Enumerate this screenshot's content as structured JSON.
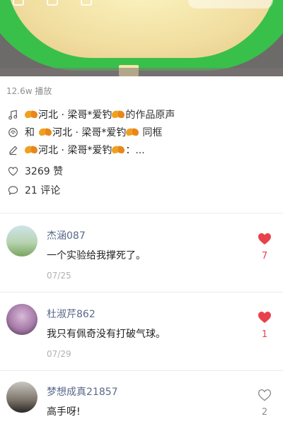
{
  "video": {
    "plays": "12.6w 播放"
  },
  "info": {
    "music_author": "河北 · 梁哥*爱钓",
    "music_suffix": "的作品原声",
    "duet_prefix": "和",
    "duet_author": "河北 · 梁哥*爱钓",
    "duet_suffix": "同框",
    "edit_author": "河北 · 梁哥*爱钓",
    "edit_suffix": "：...",
    "likes": "3269 赞",
    "comments": "21 评论"
  },
  "comments": [
    {
      "name": "杰涵087",
      "text": "一个实验给我撑死了。",
      "date": "07/25",
      "likes": "7",
      "liked": true
    },
    {
      "name": "杜淑芹862",
      "text": "我只有佩奇没有打破气球。",
      "date": "07/29",
      "likes": "1",
      "liked": true
    },
    {
      "name": "梦想成真21857",
      "text": "高手呀!",
      "date": "",
      "likes": "2",
      "liked": false
    }
  ],
  "icons": {
    "music": "music-note-icon",
    "duet": "duet-icon",
    "edit": "pencil-icon",
    "like": "heart-outline-icon",
    "comment": "comment-bubble-icon"
  },
  "colors": {
    "heart_active": "#e9414b",
    "name": "#5a6a8a",
    "muted": "#8e8e8e",
    "bowl_green": "#39c04a"
  }
}
